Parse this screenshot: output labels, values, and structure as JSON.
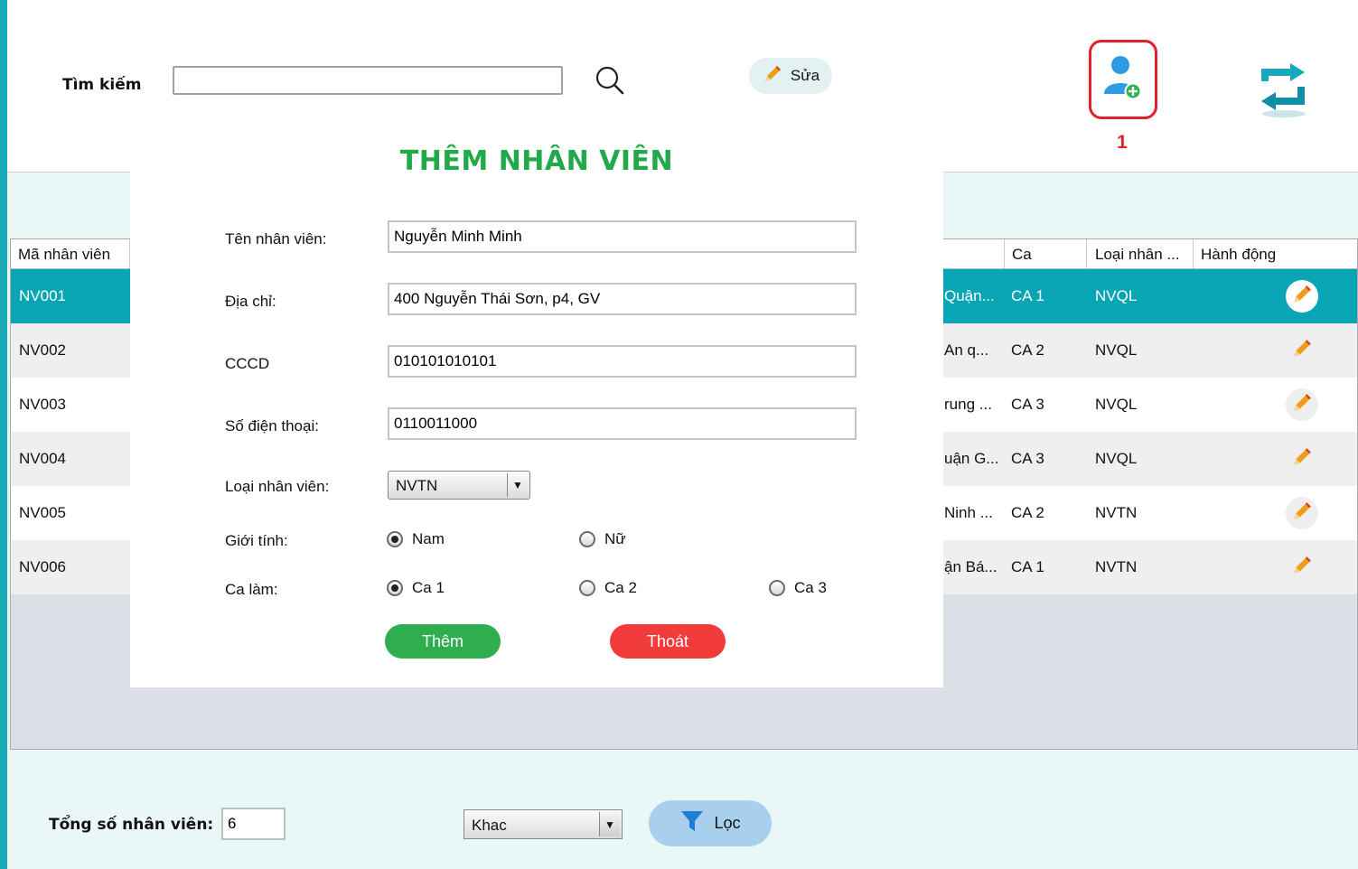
{
  "search": {
    "label": "Tìm kiếm",
    "value": ""
  },
  "toolbar": {
    "edit_label": "Sửa",
    "annotation_number": "1"
  },
  "table": {
    "columns": [
      "Mã nhân viên",
      "Ca",
      "Loại nhân ...",
      "Hành động"
    ],
    "rows": [
      {
        "id": "NV001",
        "addr": "Quận...",
        "shift": "CA 1",
        "type": "NVQL"
      },
      {
        "id": "NV002",
        "addr": "An q...",
        "shift": "CA 2",
        "type": "NVQL"
      },
      {
        "id": "NV003",
        "addr": "rung ...",
        "shift": "CA 3",
        "type": "NVQL"
      },
      {
        "id": "NV004",
        "addr": "uận G...",
        "shift": "CA 3",
        "type": "NVQL"
      },
      {
        "id": "NV005",
        "addr": "Ninh ...",
        "shift": "CA 2",
        "type": "NVTN"
      },
      {
        "id": "NV006",
        "addr": "ận Bá...",
        "shift": "CA 1",
        "type": "NVTN"
      }
    ]
  },
  "bottom": {
    "total_label": "Tổng số nhân viên:",
    "total_value": "6",
    "filter_value": "Khac",
    "filter_button": "Lọc"
  },
  "dialog": {
    "title": "THÊM NHÂN VIÊN",
    "fields": {
      "name_label": "Tên nhân viên:",
      "name_value": "Nguyễn Minh Minh",
      "address_label": "Địa chỉ:",
      "address_value": "400 Nguyễn Thái Sơn, p4, GV",
      "cccd_label": "CCCD",
      "cccd_value": "010101010101",
      "phone_label": "Số điện thoại:",
      "phone_value": "0110011000",
      "type_label": "Loại nhân viên:",
      "type_value": "NVTN",
      "gender_label": "Giới tính:",
      "gender_male": "Nam",
      "gender_female": "Nữ",
      "shift_label": "Ca làm:",
      "shift_1": "Ca 1",
      "shift_2": "Ca 2",
      "shift_3": "Ca 3"
    },
    "add_button": "Thêm",
    "exit_button": "Thoát"
  },
  "colors": {
    "accent": "#0aa5b5",
    "title_green": "#22a94a",
    "add_green": "#2eae4f",
    "exit_red": "#f23c3c",
    "highlight_red": "#e0202a"
  }
}
